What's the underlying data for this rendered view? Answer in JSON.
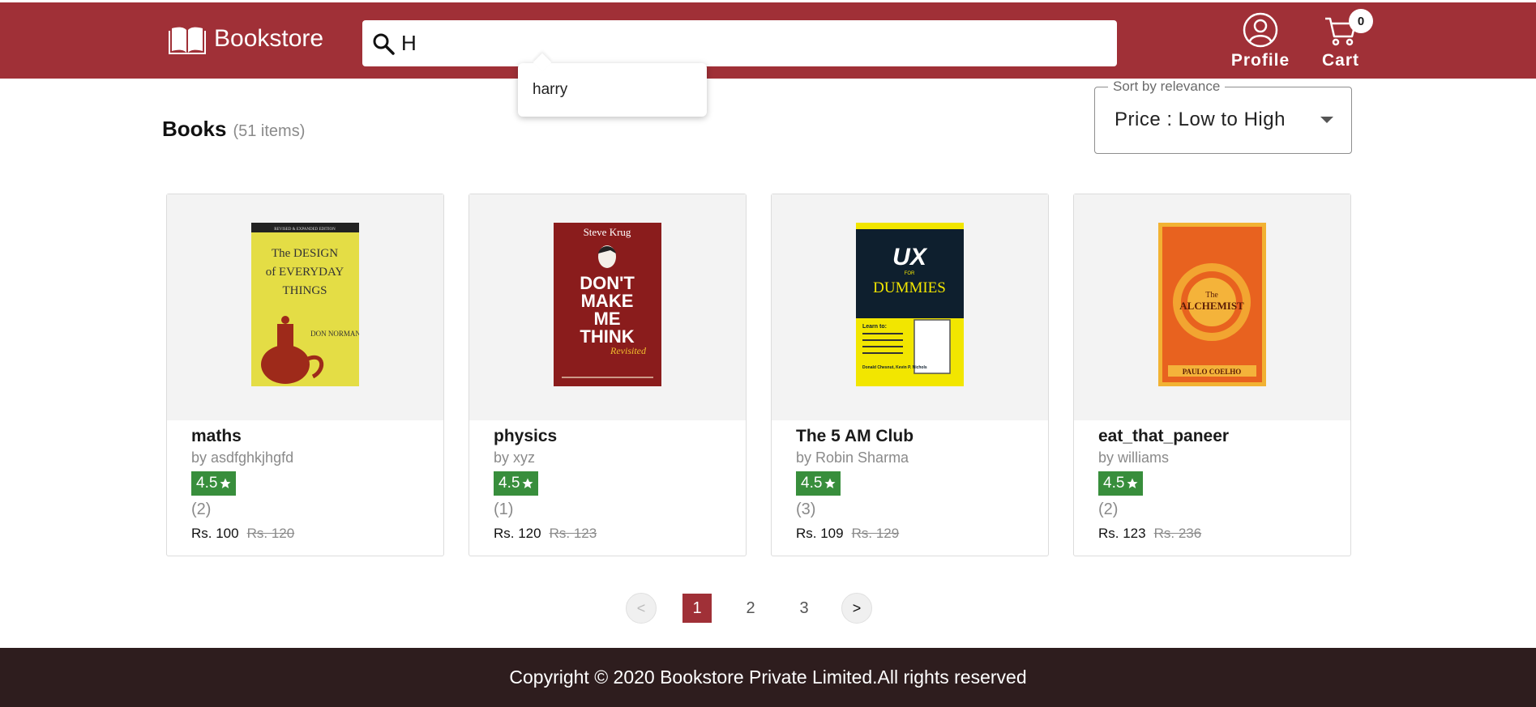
{
  "colors": {
    "brand": "#A03037",
    "footer": "#2E1D1E",
    "rating": "#388e3c"
  },
  "header": {
    "brand_name": "Bookstore",
    "brand_icon": "open-book-icon",
    "search": {
      "value": "H",
      "icon": "search-icon"
    },
    "profile_label": "Profile",
    "cart_label": "Cart",
    "cart_count": "0"
  },
  "suggestions": [
    "harry"
  ],
  "listing": {
    "heading": "Books",
    "count": "(51 items)"
  },
  "sort": {
    "legend": "Sort by relevance",
    "selected": "Price : Low to High"
  },
  "books": [
    {
      "title": "maths",
      "author": "by asdfghkjhgfd",
      "rating": "4.5",
      "reviews": "(2)",
      "price": "Rs. 100",
      "old_price": "Rs. 120",
      "cover": {
        "bg": "#E8E04A",
        "lines": [
          "The DESIGN",
          "of EVERYDAY",
          "THINGS"
        ],
        "author": "DON NORMAN",
        "top": "REVISED & EXPANDED EDITION"
      }
    },
    {
      "title": "physics",
      "author": "by xyz",
      "rating": "4.5",
      "reviews": "(1)",
      "price": "Rs. 120",
      "old_price": "Rs. 123",
      "cover": {
        "bg": "#8E1B1B",
        "lines": [
          "DON'T",
          "MAKE",
          "ME",
          "THINK"
        ],
        "author": "Steve Krug",
        "top": "Revisited"
      }
    },
    {
      "title": "The 5 AM Club",
      "author": "by Robin Sharma",
      "rating": "4.5",
      "reviews": "(3)",
      "price": "Rs. 109",
      "old_price": "Rs. 129",
      "cover": {
        "bg": "#0E1F2E",
        "lines": [
          "UX",
          "FOR",
          "DUMMIES"
        ],
        "author": "Donald Chesnut, Kevin P. Nichols",
        "top": "Learn to:"
      }
    },
    {
      "title": "eat_that_paneer",
      "author": "by williams",
      "rating": "4.5",
      "reviews": "(2)",
      "price": "Rs. 123",
      "old_price": "Rs. 236",
      "cover": {
        "bg": "#E8621F",
        "lines": [
          "The",
          "ALCHEMIST"
        ],
        "author": "PAULO COELHO",
        "top": ""
      }
    }
  ],
  "pagination": {
    "prev": "<",
    "next": ">",
    "pages": [
      "1",
      "2",
      "3"
    ],
    "current": "1"
  },
  "footer": {
    "text": "Copyright © 2020 Bookstore Private Limited.All rights reserved"
  }
}
